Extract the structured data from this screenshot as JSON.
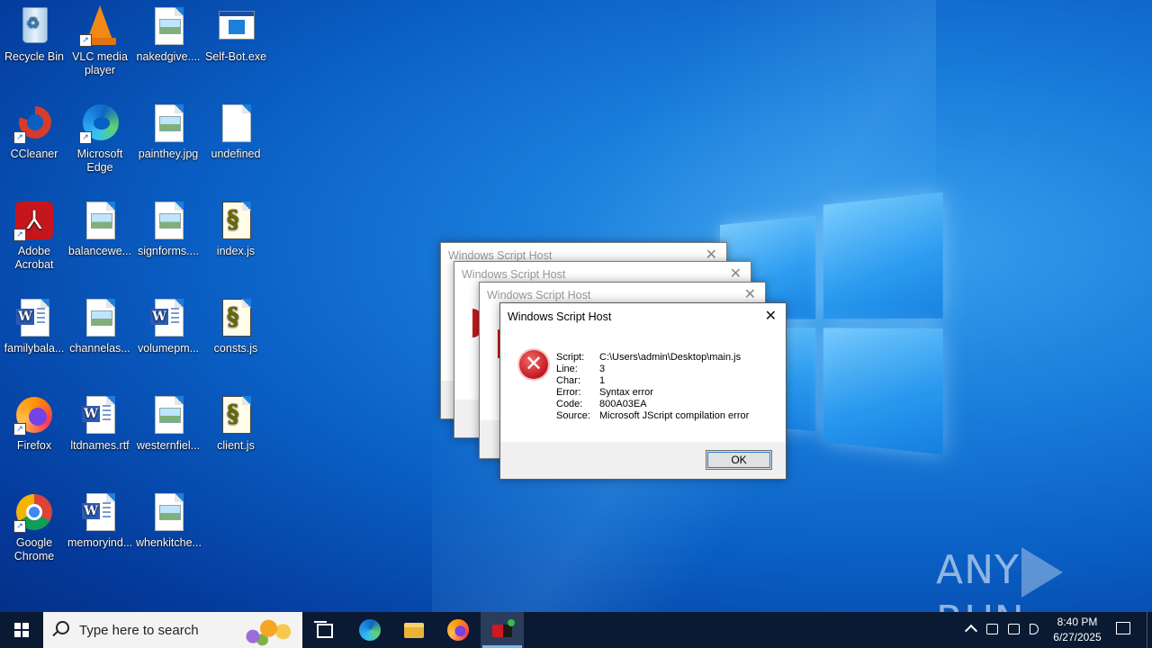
{
  "desktop": {
    "icons": [
      {
        "label": "Recycle Bin",
        "icon": "recycle-bin-icon"
      },
      {
        "label": "VLC media player",
        "icon": "vlc-icon"
      },
      {
        "label": "nakedgive....",
        "icon": "image-file-icon"
      },
      {
        "label": "Self-Bot.exe",
        "icon": "exe-icon"
      },
      {
        "label": "CCleaner",
        "icon": "ccleaner-icon"
      },
      {
        "label": "Microsoft Edge",
        "icon": "edge-icon"
      },
      {
        "label": "painthey.jpg",
        "icon": "image-file-icon"
      },
      {
        "label": "undefined",
        "icon": "blank-file-icon"
      },
      {
        "label": "Adobe Acrobat",
        "icon": "acrobat-icon"
      },
      {
        "label": "balancewe...",
        "icon": "image-file-icon"
      },
      {
        "label": "signforms....",
        "icon": "image-file-icon"
      },
      {
        "label": "index.js",
        "icon": "script-file-icon"
      },
      {
        "label": "familybala...",
        "icon": "word-file-icon"
      },
      {
        "label": "channelas...",
        "icon": "image-file-icon"
      },
      {
        "label": "volumepm...",
        "icon": "word-file-icon"
      },
      {
        "label": "consts.js",
        "icon": "script-file-icon"
      },
      {
        "label": "Firefox",
        "icon": "firefox-icon"
      },
      {
        "label": "ltdnames.rtf",
        "icon": "word-file-icon"
      },
      {
        "label": "westernfiel...",
        "icon": "image-file-icon"
      },
      {
        "label": "client.js",
        "icon": "script-file-icon"
      },
      {
        "label": "Google Chrome",
        "icon": "chrome-icon"
      },
      {
        "label": "memoryind...",
        "icon": "word-file-icon"
      },
      {
        "label": "whenkitche...",
        "icon": "image-file-icon"
      }
    ]
  },
  "dialogs": {
    "back_title": "Windows Script Host",
    "front": {
      "title": "Windows Script Host",
      "rows": [
        {
          "key": "Script:",
          "value": "C:\\Users\\admin\\Desktop\\main.js"
        },
        {
          "key": "Line:",
          "value": "3"
        },
        {
          "key": "Char:",
          "value": "1"
        },
        {
          "key": "Error:",
          "value": "Syntax error"
        },
        {
          "key": "Code:",
          "value": "800A03EA"
        },
        {
          "key": "Source:",
          "value": "Microsoft JScript compilation error"
        }
      ],
      "ok_label": "OK"
    }
  },
  "taskbar": {
    "search_placeholder": "Type here to search",
    "clock_time": "8:40 PM",
    "clock_date": "6/27/2025"
  },
  "watermark": {
    "left": "ANY",
    "right": "RUN"
  },
  "colors": {
    "taskbar": "#0b1a33",
    "accent": "#1e7ad8",
    "error": "#c2181e"
  }
}
